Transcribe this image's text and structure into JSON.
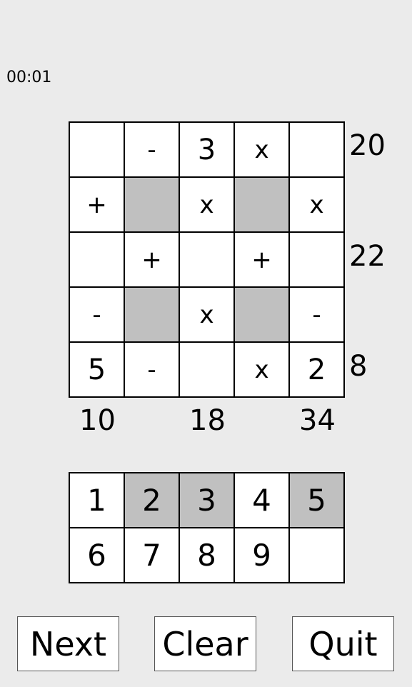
{
  "timer": "00:01",
  "grid": [
    [
      {
        "t": "",
        "k": "num"
      },
      {
        "t": "-",
        "k": "op"
      },
      {
        "t": "3",
        "k": "num"
      },
      {
        "t": "x",
        "k": "op"
      },
      {
        "t": "",
        "k": "num"
      }
    ],
    [
      {
        "t": "+",
        "k": "op"
      },
      {
        "t": "",
        "k": "blocked"
      },
      {
        "t": "x",
        "k": "op"
      },
      {
        "t": "",
        "k": "blocked"
      },
      {
        "t": "x",
        "k": "op"
      }
    ],
    [
      {
        "t": "",
        "k": "num"
      },
      {
        "t": "+",
        "k": "op"
      },
      {
        "t": "",
        "k": "num"
      },
      {
        "t": "+",
        "k": "op"
      },
      {
        "t": "",
        "k": "num"
      }
    ],
    [
      {
        "t": "-",
        "k": "op"
      },
      {
        "t": "",
        "k": "blocked"
      },
      {
        "t": "x",
        "k": "op"
      },
      {
        "t": "",
        "k": "blocked"
      },
      {
        "t": "-",
        "k": "op"
      }
    ],
    [
      {
        "t": "5",
        "k": "num"
      },
      {
        "t": "-",
        "k": "op"
      },
      {
        "t": "",
        "k": "num"
      },
      {
        "t": "x",
        "k": "op"
      },
      {
        "t": "2",
        "k": "num"
      }
    ]
  ],
  "row_results": [
    "20",
    "22",
    "8"
  ],
  "col_results": [
    "10",
    "18",
    "34"
  ],
  "keypad": [
    {
      "label": "1",
      "used": false
    },
    {
      "label": "2",
      "used": true
    },
    {
      "label": "3",
      "used": true
    },
    {
      "label": "4",
      "used": false
    },
    {
      "label": "5",
      "used": true
    },
    {
      "label": "6",
      "used": false
    },
    {
      "label": "7",
      "used": false
    },
    {
      "label": "8",
      "used": false
    },
    {
      "label": "9",
      "used": false
    },
    {
      "label": "",
      "used": false
    }
  ],
  "buttons": {
    "next": "Next",
    "clear": "Clear",
    "quit": "Quit"
  }
}
